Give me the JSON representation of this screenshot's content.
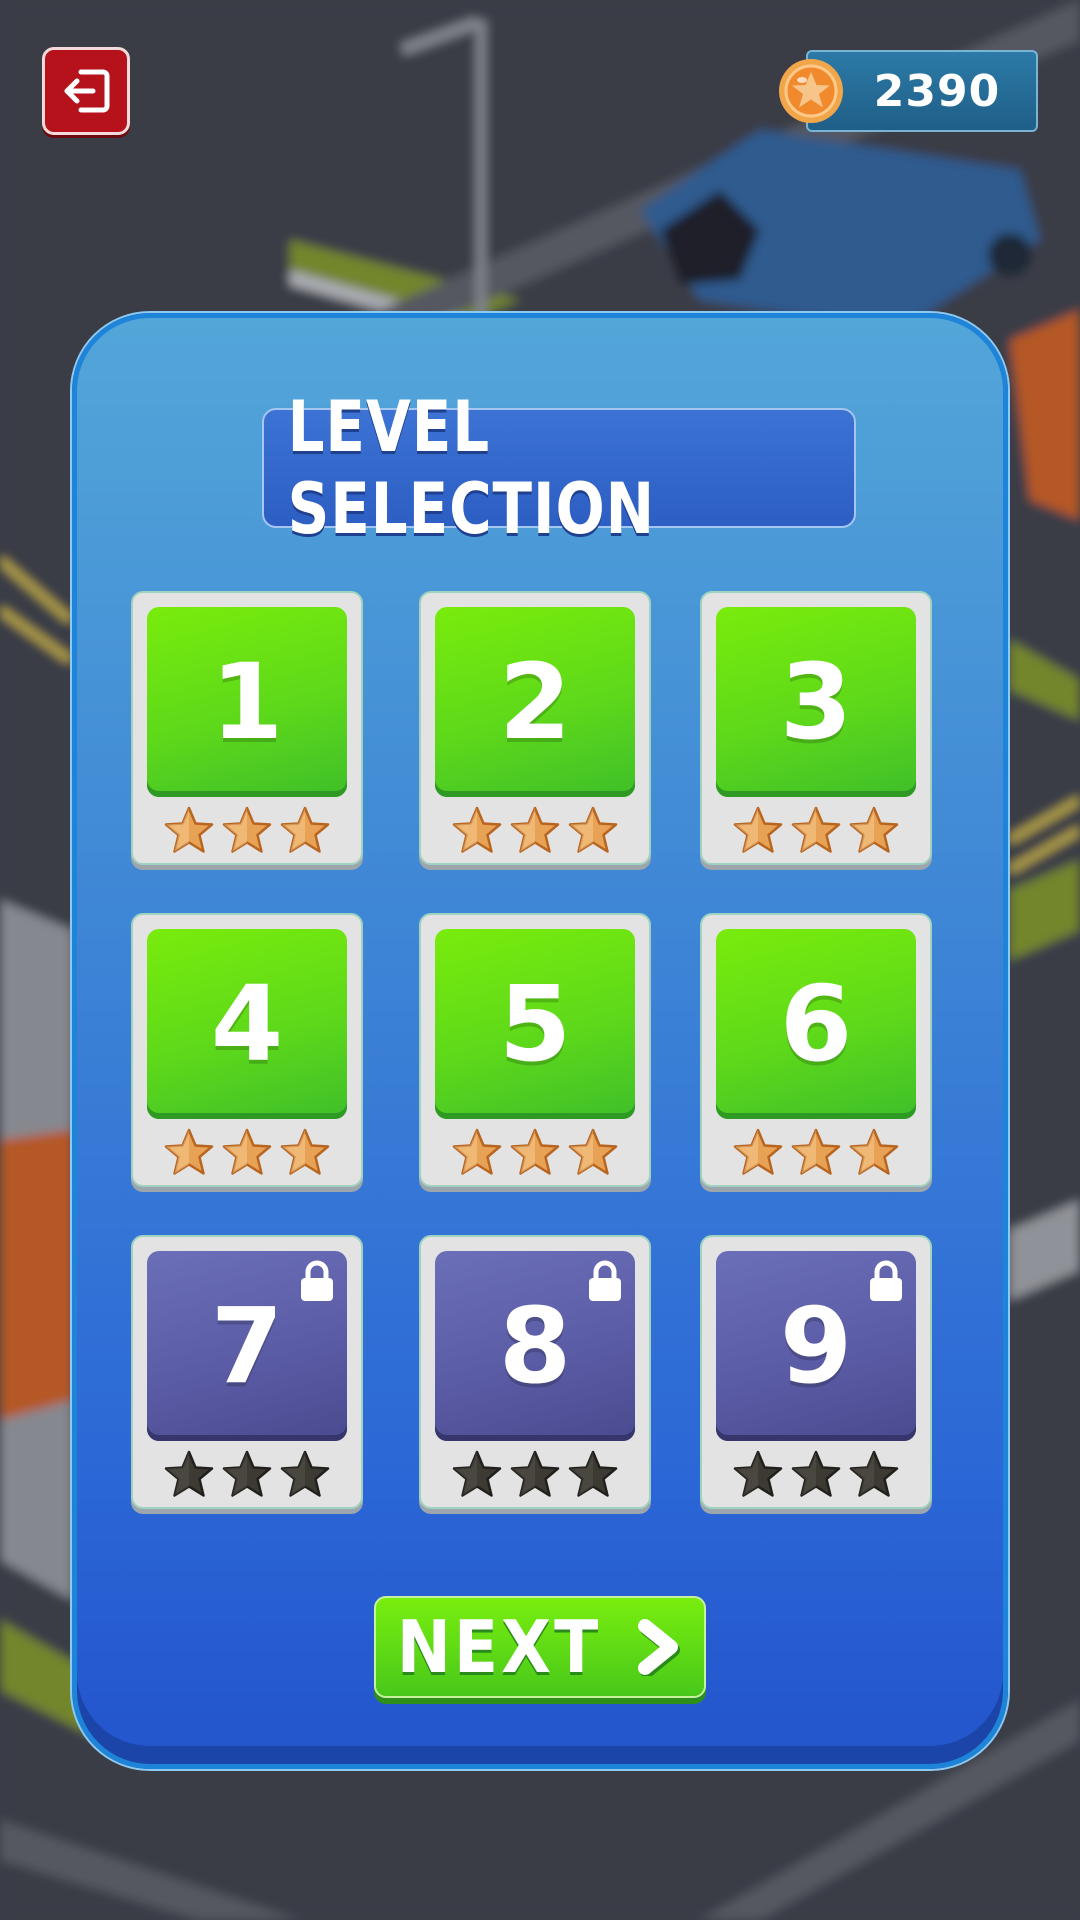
{
  "header": {
    "exit_icon": "exit-icon",
    "coins": "2390",
    "coin_icon": "star-coin-icon"
  },
  "panel": {
    "title": "LEVEL SELECTION"
  },
  "levels": [
    {
      "number": "1",
      "locked": false,
      "stars_earned": 3
    },
    {
      "number": "2",
      "locked": false,
      "stars_earned": 3
    },
    {
      "number": "3",
      "locked": false,
      "stars_earned": 3
    },
    {
      "number": "4",
      "locked": false,
      "stars_earned": 3
    },
    {
      "number": "5",
      "locked": false,
      "stars_earned": 3
    },
    {
      "number": "6",
      "locked": false,
      "stars_earned": 3
    },
    {
      "number": "7",
      "locked": true,
      "stars_earned": 0
    },
    {
      "number": "8",
      "locked": true,
      "stars_earned": 0
    },
    {
      "number": "9",
      "locked": true,
      "stars_earned": 0
    }
  ],
  "next_button": {
    "label": "NEXT",
    "icon": "chevron-right-icon"
  },
  "colors": {
    "star_gold": "#e8a256",
    "star_empty": "#3d3a34",
    "tile_unlocked": "#5ed91a",
    "tile_locked": "#5b5ca6",
    "panel_blue": "#3f87d6"
  }
}
